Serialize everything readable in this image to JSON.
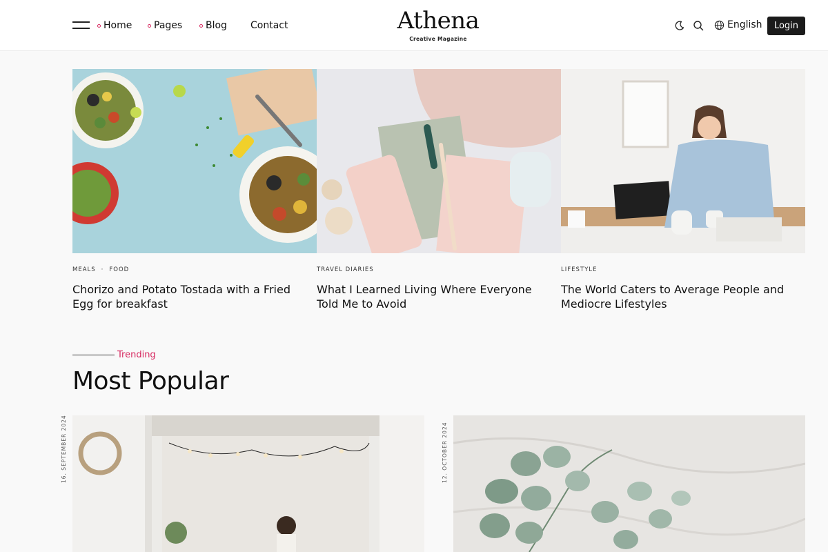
{
  "header": {
    "nav": [
      {
        "label": "Home",
        "dot": true
      },
      {
        "label": "Pages",
        "dot": true
      },
      {
        "label": "Blog",
        "dot": true
      },
      {
        "label": "Contact",
        "dot": false
      }
    ],
    "logo": {
      "title": "Athena",
      "subtitle": "Creative Magazine"
    },
    "icons": [
      "menu-icon",
      "moon-icon",
      "search-icon",
      "globe-icon"
    ],
    "language": "English",
    "login_label": "Login",
    "accent_color": "#d6255d"
  },
  "featured": [
    {
      "categories": [
        "MEALS",
        "FOOD"
      ],
      "title": "Chorizo and Potato Tostada with a Fried Egg for breakfast",
      "image": "food salad bowls on light blue background"
    },
    {
      "categories": [
        "TRAVEL DIARIES"
      ],
      "title": "What I Learned Living Where Everyone Told Me to Avoid",
      "image": "pink phone, notebooks and earrings flat lay"
    },
    {
      "categories": [
        "LIFESTYLE"
      ],
      "title": "The World Caters to Average People and Mediocre Lifestyles",
      "image": "woman on phone at desk with laptop"
    }
  ],
  "section": {
    "eyebrow": "Trending",
    "title": "Most Popular"
  },
  "popular": [
    {
      "date": "16. SEPTEMBER 2024",
      "image": "woman working in bright room with string lights"
    },
    {
      "date": "12. OCTOBER 2024",
      "image": "eucalyptus branch on white linen"
    }
  ]
}
